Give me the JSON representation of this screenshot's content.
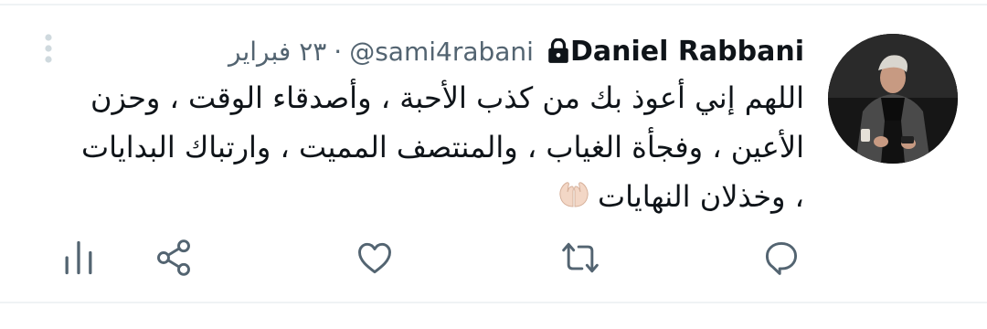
{
  "tweet": {
    "display_name": "Daniel Rabbani",
    "handle": "@sami4rabani",
    "separator": "·",
    "date": "٢٣ فبراير",
    "text": "اللهم إني أعوذ بك من كذب الأحبة ، وأصدقاء الوقت ، وحزن الأعين ، وفجأة الغياب ، والمنتصف المميت ، وارتباك البدايات ، وخذلان النهايات",
    "emoji": "praying-hands-light-skin"
  },
  "icons": {
    "avatar": "profile-photo",
    "lock": "lock-icon",
    "more": "more-vertical-icon",
    "reply": "reply-icon",
    "retweet": "retweet-icon",
    "like": "like-icon",
    "share": "share-icon",
    "analytics": "analytics-icon"
  },
  "colors": {
    "text": "#0f1419",
    "secondary": "#536471",
    "icon": "#536471",
    "divider": "#eff3f4",
    "muted_icon": "#cfd9de"
  }
}
